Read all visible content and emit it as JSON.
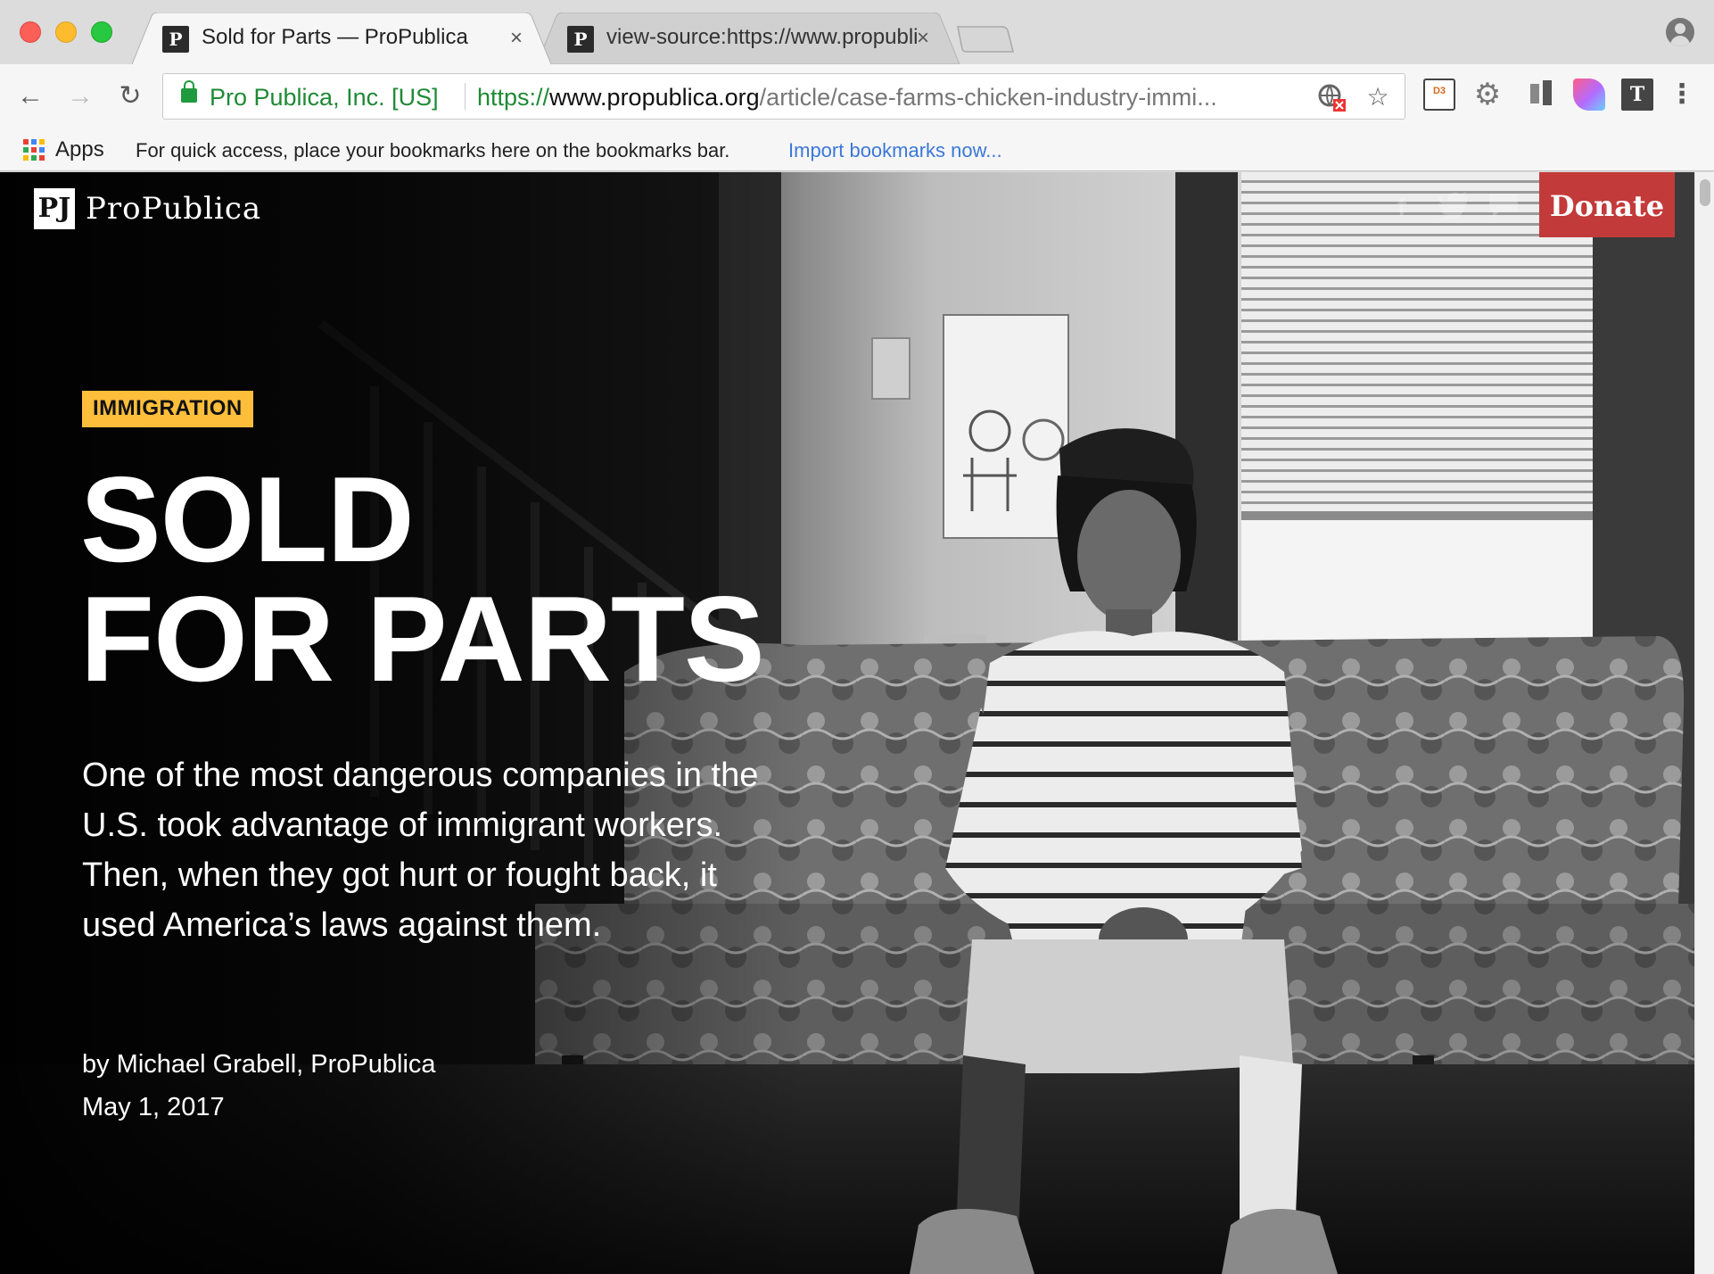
{
  "tabs": [
    {
      "favicon": "PP",
      "title": "Sold for Parts — ProPublica",
      "active": true
    },
    {
      "favicon": "PP",
      "title": "view-source:https://www.propublica.org",
      "active": false
    }
  ],
  "toolbar": {
    "cert_name": "Pro Publica, Inc. [US]",
    "url_scheme": "https://",
    "url_host": "www.propublica.org",
    "url_path": "/article/case-farms-chicken-industry-immi..."
  },
  "bookmarks_bar": {
    "apps_label": "Apps",
    "hint": "For quick access, place your bookmarks here on the bookmarks bar.",
    "import_link": "Import bookmarks now..."
  },
  "icons": {
    "back": "back-arrow-icon",
    "forward": "forward-arrow-icon",
    "reload": "reload-icon",
    "bookmark_star": "star-icon",
    "menu": "three-dot-menu-icon",
    "profile": "profile-icon"
  },
  "site": {
    "logo_mark": "PJ",
    "logo_text": "ProPublica",
    "donate_label": "Donate",
    "social": [
      "facebook-icon",
      "twitter-icon",
      "comment-icon"
    ]
  },
  "article": {
    "kicker": "IMMIGRATION",
    "headline_line1": "SOLD",
    "headline_line2": "FOR PARTS",
    "dek": "One of the most dangerous companies in the U.S. took advantage of immigrant workers. Then, when they got hurt or fought back, it used America’s laws against them.",
    "byline": "by Michael Grabell, ProPublica",
    "date": "May 1, 2017"
  },
  "colors": {
    "donate": "#c33a3a",
    "kicker": "#fdbe3b",
    "secure_green": "#1f8a36",
    "link_blue": "#3b78d8"
  }
}
